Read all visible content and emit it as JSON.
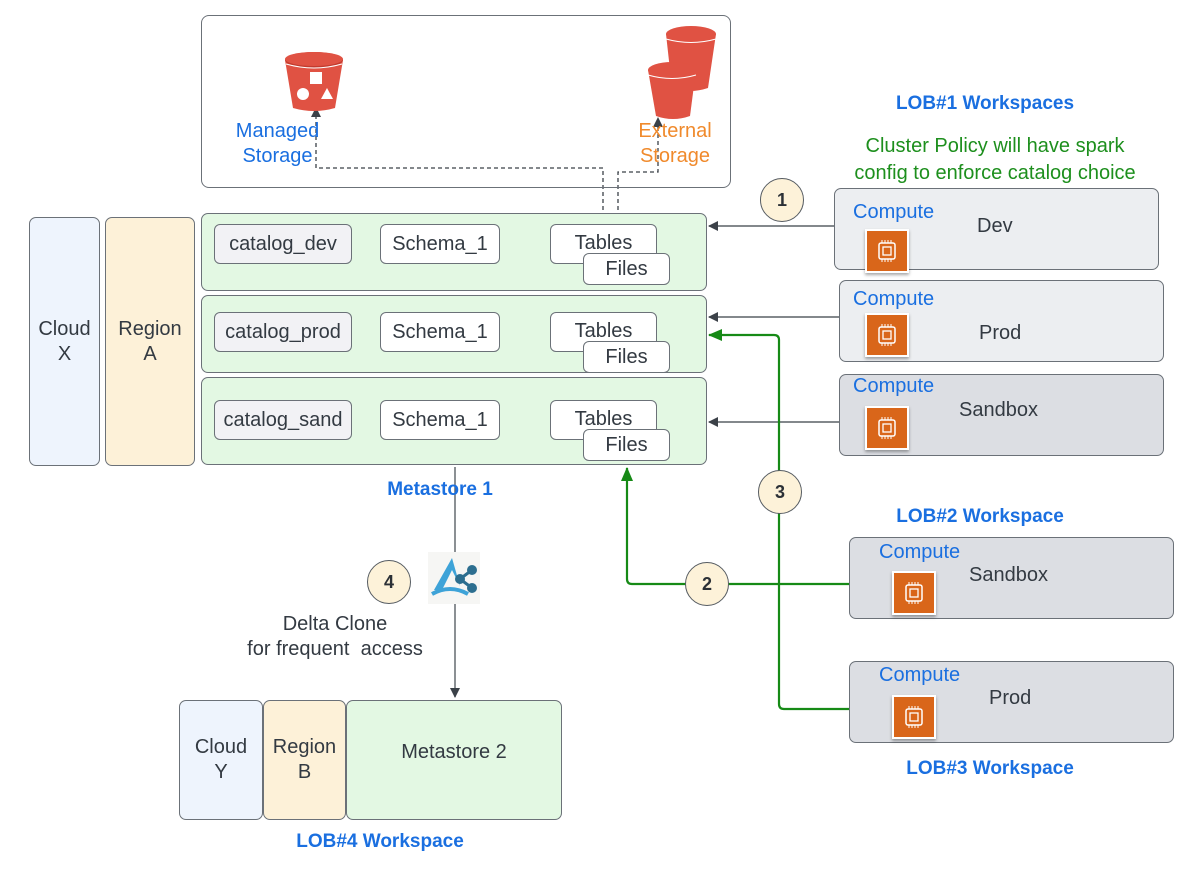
{
  "storage_panel": {
    "managed_label_line1": "Managed",
    "managed_label_line2": "Storage",
    "external_label_line1": "External",
    "external_label_line2": "Storage",
    "managed_icon": "s3-bucket-objects-icon",
    "external_icon": "s3-buckets-icon"
  },
  "region_a": {
    "cloud_line1": "Cloud",
    "cloud_line2": "X",
    "region_line1": "Region",
    "region_line2": "A",
    "metastore_label": "Metastore 1",
    "catalogs": [
      {
        "catalog": "catalog_dev",
        "schema": "Schema_1",
        "tables": "Tables",
        "files": "Files"
      },
      {
        "catalog": "catalog_prod",
        "schema": "Schema_1",
        "tables": "Tables",
        "files": "Files"
      },
      {
        "catalog": "catalog_sand",
        "schema": "Schema_1",
        "tables": "Tables",
        "files": "Files"
      }
    ]
  },
  "lob1": {
    "title": "LOB#1 Workspaces",
    "note_line1": "Cluster Policy will have spark",
    "note_line2": "config to enforce catalog choice",
    "workspaces": [
      {
        "compute": "Compute",
        "name": "Dev"
      },
      {
        "compute": "Compute",
        "name": "Prod"
      },
      {
        "compute": "Compute",
        "name": "Sandbox"
      }
    ]
  },
  "lob2": {
    "title": "LOB#2 Workspace",
    "compute": "Compute",
    "name": "Sandbox"
  },
  "lob3": {
    "title": "LOB#3 Workspace",
    "compute": "Compute",
    "name": "Prod"
  },
  "steps": [
    "1",
    "2",
    "3",
    "4"
  ],
  "delta_clone": {
    "line1": "Delta Clone",
    "line2": "for frequent  access",
    "icon": "delta-sharing-icon"
  },
  "region_b": {
    "cloud_line1": "Cloud",
    "cloud_line2": "Y",
    "region_line1": "Region",
    "region_line2": "B",
    "metastore": "Metastore 2",
    "workspace_label": "LOB#4 Workspace"
  },
  "colors": {
    "accent_blue": "#1a6fe0",
    "accent_orange": "#f08a2c",
    "policy_green": "#1d8f1d",
    "bucket_red": "#e05243",
    "compute_orange": "#d9661a"
  }
}
